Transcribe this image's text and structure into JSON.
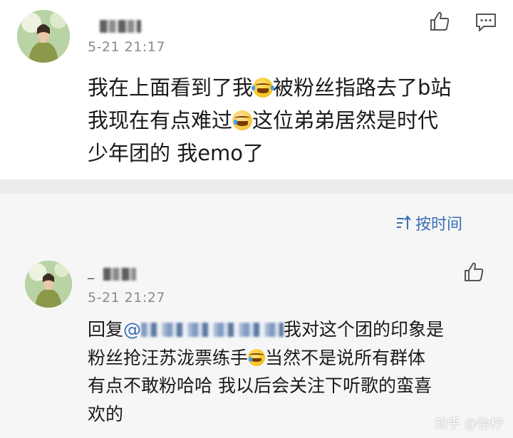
{
  "top_comment": {
    "username_prefix": "",
    "timestamp": "5-21  21:17",
    "lines": [
      [
        "我在上面看到了我",
        "被粉丝指路去了b站"
      ],
      [
        "我现在有点难过",
        "这位弟弟居然是时代"
      ],
      [
        "少年团的  我emo了",
        ""
      ]
    ],
    "emojis": [
      "laugh-cry-emoji",
      "cry-emoji"
    ]
  },
  "sort": {
    "label": "按时间",
    "icon": "sort-icon"
  },
  "reply": {
    "username_prefix": "_",
    "timestamp": "5-21  21:27",
    "reply_prefix": "回复",
    "mention_prefix": "@",
    "line1_suffix": "我对这个团的印象是",
    "line2_a": "粉丝抢汪苏泷票练手",
    "line2_b": "当然不是说所有群体",
    "line3": "有点不敢粉哈哈  我以后会关注下听歌的蛮喜",
    "line4": "欢的"
  },
  "watermark": "知乎 @怡柠",
  "colors": {
    "accent": "#3a6fb5",
    "timestamp": "#8a8a8a",
    "divider": "#ececec",
    "reply_bg": "#f6f6f6"
  }
}
